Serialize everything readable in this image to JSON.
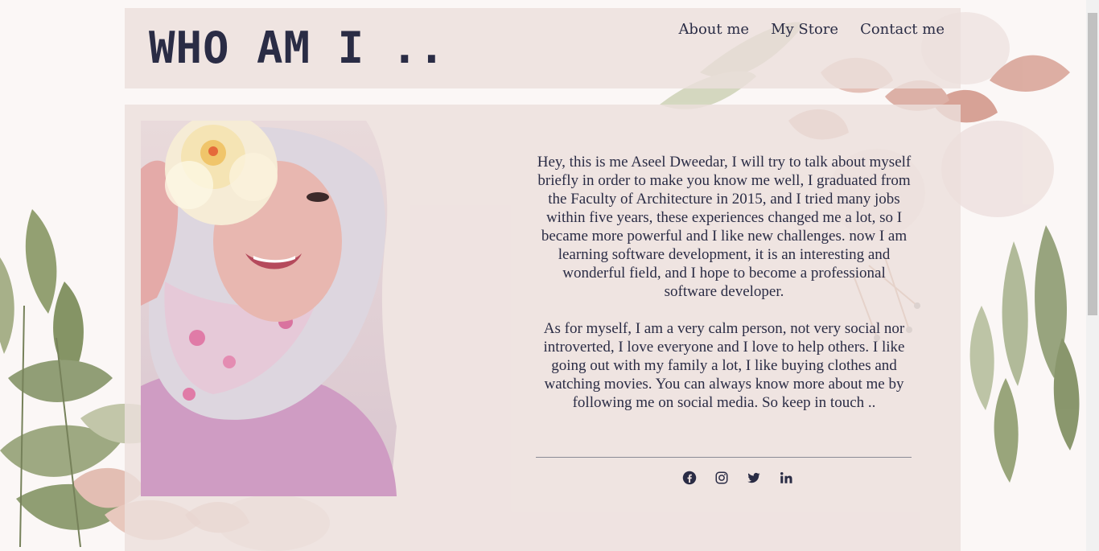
{
  "header": {
    "title": "WHO AM I .."
  },
  "nav": {
    "items": [
      {
        "label": "About me"
      },
      {
        "label": "My Store"
      },
      {
        "label": "Contact me"
      }
    ]
  },
  "bio": {
    "paragraph1": "Hey, this is me Aseel Dweedar, I will try to talk about myself briefly in order to make you know me well, I graduated from the Faculty of Architecture in 2015, and I tried many jobs within five years, these experiences changed me a lot, so I became more powerful and I like new challenges. now I am learning software development, it is an interesting and wonderful field, and I hope to become a professional software developer.",
    "paragraph2": "As for myself, I am a very calm person, not very social nor introverted, I love everyone and I love to help others. I like going out with my family a lot, I like buying clothes and watching movies. You can always know more about me by following me on social media. So keep in touch .."
  },
  "social": {
    "icons": [
      "facebook-icon",
      "instagram-icon",
      "twitter-icon",
      "linkedin-icon"
    ]
  },
  "colors": {
    "text": "#2a2c45",
    "card": "#ecdfdc",
    "page": "#fbf7f6"
  }
}
